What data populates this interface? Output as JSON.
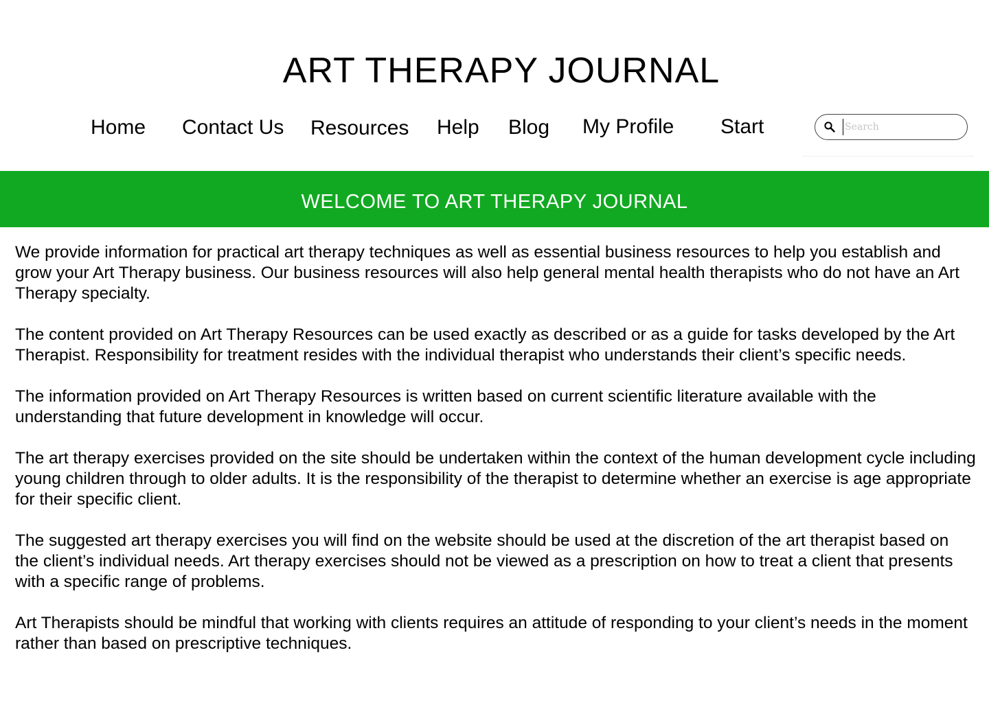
{
  "site": {
    "title": "ART THERAPY JOURNAL"
  },
  "nav": {
    "items": [
      {
        "label": "Home"
      },
      {
        "label": "Contact Us"
      },
      {
        "label": "Resources"
      },
      {
        "label": "Help"
      },
      {
        "label": "Blog"
      },
      {
        "label": "My Profile"
      },
      {
        "label": "Start"
      }
    ]
  },
  "search": {
    "placeholder": "Search",
    "value": "",
    "icon": "search-icon"
  },
  "banner": {
    "text": "WELCOME TO ART THERAPY JOURNAL",
    "color": "#12a922"
  },
  "content": {
    "paragraphs": [
      "We provide information for practical art therapy techniques as well as essential business resources to help you establish and grow your Art Therapy business. Our business resources will also help general mental health therapists who do not have an Art Therapy specialty.",
      "The content provided on Art Therapy Resources can be used exactly as described or as a guide for tasks developed by the Art Therapist. Responsibility for treatment resides with the individual therapist who understands their client’s specific needs.",
      "The information provided on Art Therapy Resources is written based on current scientific literature available with the understanding that future development in knowledge will occur.",
      "The art therapy exercises provided on the site should be undertaken within the context of the human development cycle including young children through to older adults. It is the responsibility of the therapist to determine whether an exercise is age appropriate for their specific client.",
      "The suggested art therapy exercises you will find on the website should be used at the discretion of the art therapist based on the client’s individual needs. Art therapy exercises should not be viewed as a prescription on how to treat a client that presents with a specific range of problems.",
      "Art Therapists should be mindful that working with clients requires an attitude of responding to your client’s needs in the moment rather than based on prescriptive techniques."
    ]
  }
}
